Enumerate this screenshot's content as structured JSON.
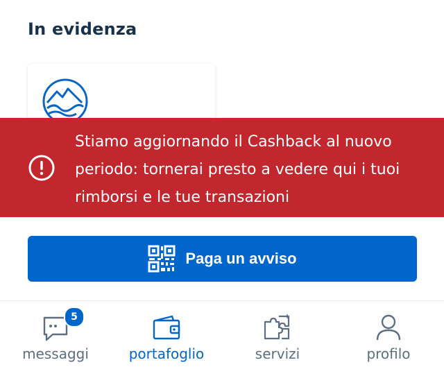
{
  "section": {
    "title": "In evidenza"
  },
  "banner": {
    "lines": [
      "Stiamo aggiornando il Cashback al nuovo",
      "periodo: tornerai presto a vedere qui i tuoi",
      "rimborsi e le tue transazioni"
    ],
    "color": "#c1272d",
    "icon": "exclamation-circle-icon"
  },
  "pay_button": {
    "label": "Paga un avviso",
    "icon": "qr-code-icon",
    "color": "#0066cc"
  },
  "tabbar": {
    "tabs": [
      {
        "label": "messaggi",
        "icon": "message-icon",
        "badge": "5"
      },
      {
        "label": "portafoglio",
        "icon": "wallet-icon",
        "active": true
      },
      {
        "label": "servizi",
        "icon": "puzzle-icon"
      },
      {
        "label": "profilo",
        "icon": "user-icon"
      }
    ]
  }
}
